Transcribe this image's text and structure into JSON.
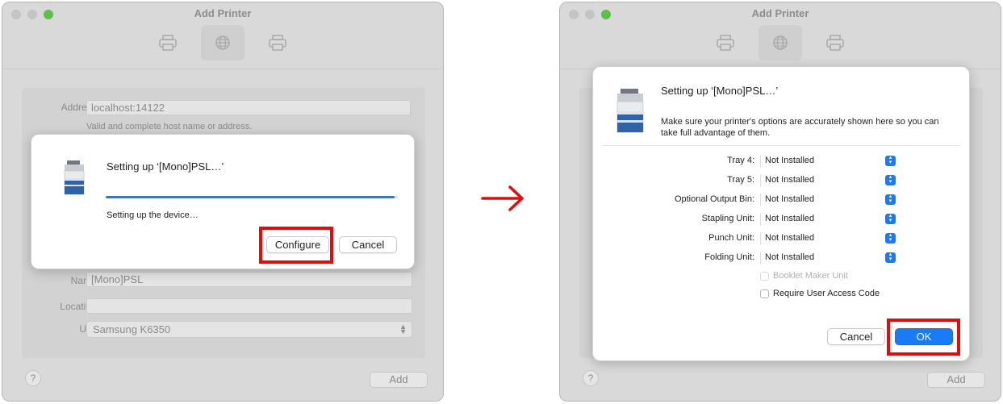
{
  "left_window": {
    "title": "Add Printer",
    "form": {
      "address_label": "Address:",
      "address_value": "localhost:14122",
      "address_hint": "Valid and complete host name or address.",
      "name_label": "Name:",
      "name_value": "[Mono]PSL",
      "location_label": "Location:",
      "location_value": "",
      "use_label": "Use:",
      "use_value": "Samsung K6350"
    },
    "help_label": "?",
    "add_label": "Add",
    "sheet": {
      "title": "Setting up ‘[Mono]PSL…’",
      "progress": 0.99,
      "status": "Setting up the device…",
      "configure_label": "Configure",
      "cancel_label": "Cancel"
    }
  },
  "arrow_icon": "right-arrow-icon",
  "right_window": {
    "title": "Add Printer",
    "help_label": "?",
    "add_label": "Add",
    "sheet": {
      "title": "Setting up ‘[Mono]PSL…’",
      "description": "Make sure your printer's options are accurately shown here so you can take full advantage of them.",
      "options": [
        {
          "label": "Tray 4:",
          "value": "Not Installed"
        },
        {
          "label": "Tray 5:",
          "value": "Not Installed"
        },
        {
          "label": "Optional Output Bin:",
          "value": "Not Installed"
        },
        {
          "label": "Stapling Unit:",
          "value": "Not Installed"
        },
        {
          "label": "Punch Unit:",
          "value": "Not Installed"
        },
        {
          "label": "Folding Unit:",
          "value": "Not Installed"
        }
      ],
      "checkboxes": [
        {
          "label": "Booklet Maker Unit",
          "disabled": true,
          "checked": false
        },
        {
          "label": "Require User Access Code",
          "disabled": false,
          "checked": false
        }
      ],
      "cancel_label": "Cancel",
      "ok_label": "OK"
    }
  },
  "colors": {
    "accent": "#1a7cf5",
    "highlight": "#e30b0b",
    "window_bg": "#d9d9d9",
    "traffic_green": "#5fbd4d"
  }
}
